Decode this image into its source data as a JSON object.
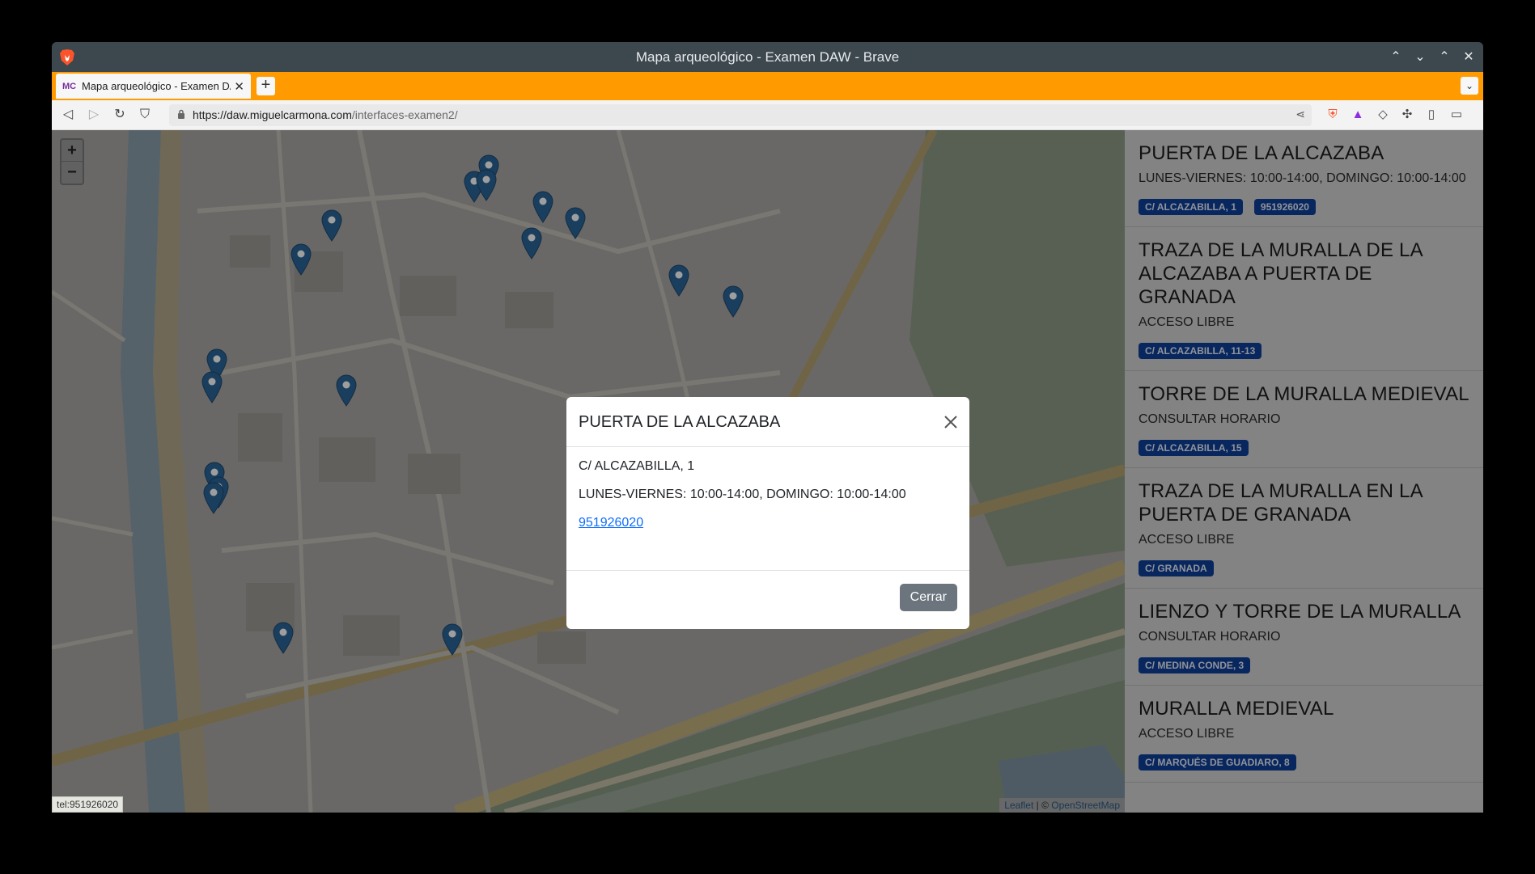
{
  "window": {
    "title": "Mapa arqueológico - Examen DAW - Brave"
  },
  "tab": {
    "favicon": "MC",
    "label": "Mapa arqueológico - Examen DAW"
  },
  "toolbar": {
    "url_host": "https://daw.miguelcarmona.com",
    "url_path": "/interfaces-examen2/"
  },
  "map": {
    "zoom_in": "+",
    "zoom_out": "−",
    "attribution_leaflet": "Leaflet",
    "attribution_sep": " | © ",
    "attribution_osm": "OpenStreetMap",
    "status_url": "tel:951926020"
  },
  "modal": {
    "title": "PUERTA DE LA ALCAZABA",
    "address": "C/ ALCAZABILLA, 1",
    "hours": "LUNES-VIERNES: 10:00-14:00, DOMINGO: 10:00-14:00",
    "phone": "951926020",
    "close_label": "Cerrar"
  },
  "sidebar": {
    "items": [
      {
        "title": "PUERTA DE LA ALCAZABA",
        "hours": "LUNES-VIERNES: 10:00-14:00, DOMINGO: 10:00-14:00",
        "badges": [
          "C/ ALCAZABILLA, 1",
          "951926020"
        ]
      },
      {
        "title": "TRAZA DE LA MURALLA DE LA ALCAZABA A PUERTA DE GRANADA",
        "hours": "ACCESO LIBRE",
        "badges": [
          "C/ ALCAZABILLA, 11-13"
        ]
      },
      {
        "title": "TORRE DE LA MURALLA MEDIEVAL",
        "hours": "CONSULTAR HORARIO",
        "badges": [
          "C/ ALCAZABILLA, 15"
        ]
      },
      {
        "title": "TRAZA DE LA MURALLA EN LA PUERTA DE GRANADA",
        "hours": "ACCESO LIBRE",
        "badges": [
          "C/ GRANADA"
        ]
      },
      {
        "title": "LIENZO Y TORRE DE LA MURALLA",
        "hours": "CONSULTAR HORARIO",
        "badges": [
          "C/ MEDINA CONDE, 3"
        ]
      },
      {
        "title": "MURALLA MEDIEVAL",
        "hours": "ACCESO LIBRE",
        "badges": [
          "C/ MARQUÉS DE GUADIARO, 8"
        ]
      }
    ]
  },
  "colors": {
    "tabbar": "#ff9b00",
    "badge": "#0d3f9a",
    "marker": "#2a6496",
    "button": "#6c757d"
  }
}
